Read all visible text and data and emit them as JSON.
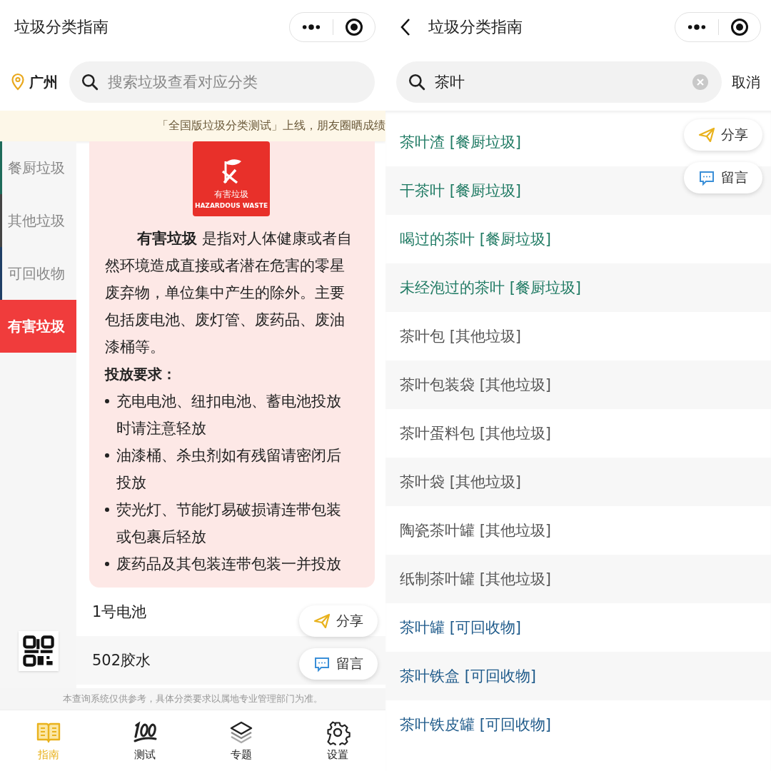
{
  "left_screen": {
    "title": "垃圾分类指南",
    "location": "广州",
    "search": {
      "placeholder": "搜索垃圾查看对应分类"
    },
    "notice": "「全国版垃圾分类测试」上线，朋友圈晒成绩",
    "categories": [
      {
        "label": "餐厨垃圾",
        "selected": false,
        "color": "#1e6b5a"
      },
      {
        "label": "其他垃圾",
        "selected": false,
        "color": "#444444"
      },
      {
        "label": "可回收物",
        "selected": false,
        "color": "#1f3f66"
      },
      {
        "label": "有害垃圾",
        "selected": true,
        "color": "#f03c3c"
      }
    ],
    "detail": {
      "badge_title": "有害垃圾",
      "badge_subtitle": "HAZARDOUS WASTE",
      "description": "**有害垃圾** 是指对人体健康或者自然环境造成直接或者潜在危害的零星废弃物，单位集中产生的除外。主要包括废电池、废灯管、废药品、废油漆桶等。",
      "requirements_heading": "投放要求：",
      "requirements": [
        "充电电池、纽扣电池、蓄电池投放时请注意轻放",
        "油漆桶、杀虫剂如有残留请密闭后投放",
        "荧光灯、节能灯易破损请连带包装或包裹后轻放",
        "废药品及其包装连带包装一并投放"
      ]
    },
    "items": [
      "1号电池",
      "502胶水"
    ],
    "float_buttons": [
      {
        "label": "分享",
        "kind": "share"
      },
      {
        "label": "留言",
        "kind": "comment"
      }
    ],
    "disclaimer": "本查询系统仅供参考，具体分类要求以属地专业管理部门为准。",
    "tabs": [
      {
        "label": "指南",
        "selected": true,
        "kind": "guide"
      },
      {
        "label": "测试",
        "selected": false,
        "kind": "test"
      },
      {
        "label": "专题",
        "selected": false,
        "kind": "topics"
      },
      {
        "label": "设置",
        "selected": false,
        "kind": "settings"
      }
    ]
  },
  "right_screen": {
    "title": "垃圾分类指南",
    "search": {
      "value": "茶叶"
    },
    "cancel": "取消",
    "results": [
      {
        "text": "茶叶渣 [餐厨垃圾]",
        "color": "#1f7a63"
      },
      {
        "text": "干茶叶 [餐厨垃圾]",
        "color": "#1f7a63"
      },
      {
        "text": "喝过的茶叶 [餐厨垃圾]",
        "color": "#1f7a63"
      },
      {
        "text": "未经泡过的茶叶 [餐厨垃圾]",
        "color": "#1f7a63"
      },
      {
        "text": "茶叶包 [其他垃圾]",
        "color": "#555555"
      },
      {
        "text": "茶叶包装袋 [其他垃圾]",
        "color": "#555555"
      },
      {
        "text": "茶叶蛋料包 [其他垃圾]",
        "color": "#555555"
      },
      {
        "text": "茶叶袋 [其他垃圾]",
        "color": "#555555"
      },
      {
        "text": "陶瓷茶叶罐 [其他垃圾]",
        "color": "#555555"
      },
      {
        "text": "纸制茶叶罐 [其他垃圾]",
        "color": "#555555"
      },
      {
        "text": "茶叶罐 [可回收物]",
        "color": "#1e5a8a"
      },
      {
        "text": "茶叶铁盒 [可回收物]",
        "color": "#1e5a8a"
      },
      {
        "text": "茶叶铁皮罐 [可回收物]",
        "color": "#1e5a8a"
      }
    ],
    "float_buttons": [
      {
        "label": "分享",
        "kind": "share"
      },
      {
        "label": "留言",
        "kind": "comment"
      }
    ]
  }
}
